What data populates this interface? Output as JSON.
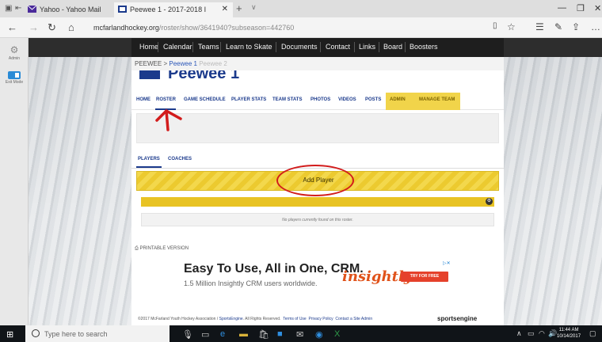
{
  "browser": {
    "tabs": [
      {
        "label": "Yahoo - Yahoo Mail"
      },
      {
        "label": "Peewee 1 - 2017-2018 I"
      }
    ],
    "url_host": "mcfarlandhockey.org",
    "url_path": "/roster/show/3641940?subseason=442760"
  },
  "rail": {
    "admin_label": "Admin",
    "edit_mode_label": "Exit Mode"
  },
  "site_nav": [
    "Home",
    "Calendar",
    "Teams",
    "Learn to Skate",
    "Documents",
    "Contact",
    "Links",
    "Board",
    "Boosters"
  ],
  "breadcrumb": {
    "root": "PEEWEE",
    "sep": ">",
    "current": "Peewee 1",
    "ghost": "Peewee 2"
  },
  "team": {
    "name": "Peewee 1"
  },
  "subnav": [
    "HOME",
    "ROSTER",
    "GAME SCHEDULE",
    "PLAYER STATS",
    "TEAM STATS",
    "PHOTOS",
    "VIDEOS",
    "POSTS",
    "ADMIN",
    "MANAGE TEAM"
  ],
  "roster_tabs": [
    "PLAYERS",
    "COACHES"
  ],
  "add_player": "Add Player",
  "empty_msg": "No players currently found on this roster.",
  "printable": "PRINTABLE VERSION",
  "ad": {
    "headline": "Easy To Use, All in One, CRM.",
    "sub": "1.5 Million Insightly CRM users worldwide.",
    "brand": "insightly",
    "cta": "TRY FOR FREE"
  },
  "footer": {
    "copyright": "©2017 McFarland Youth Hockey Association / ",
    "se_link": "SportsEngine",
    "rights": ". All Rights Reserved.",
    "terms": "Terms of Use",
    "privacy": "Privacy Policy",
    "contact": "Contact a Site Admin",
    "brand": "sportsengine"
  },
  "taskbar": {
    "search_placeholder": "Type here to search",
    "time": "11:44 AM",
    "date": "10/14/2017"
  },
  "colors": {
    "nav_dark": "#1e1e1e",
    "accent_yellow": "#f1d44a",
    "brand_blue": "#1b3a8c",
    "annotation_red": "#d21c1c"
  }
}
